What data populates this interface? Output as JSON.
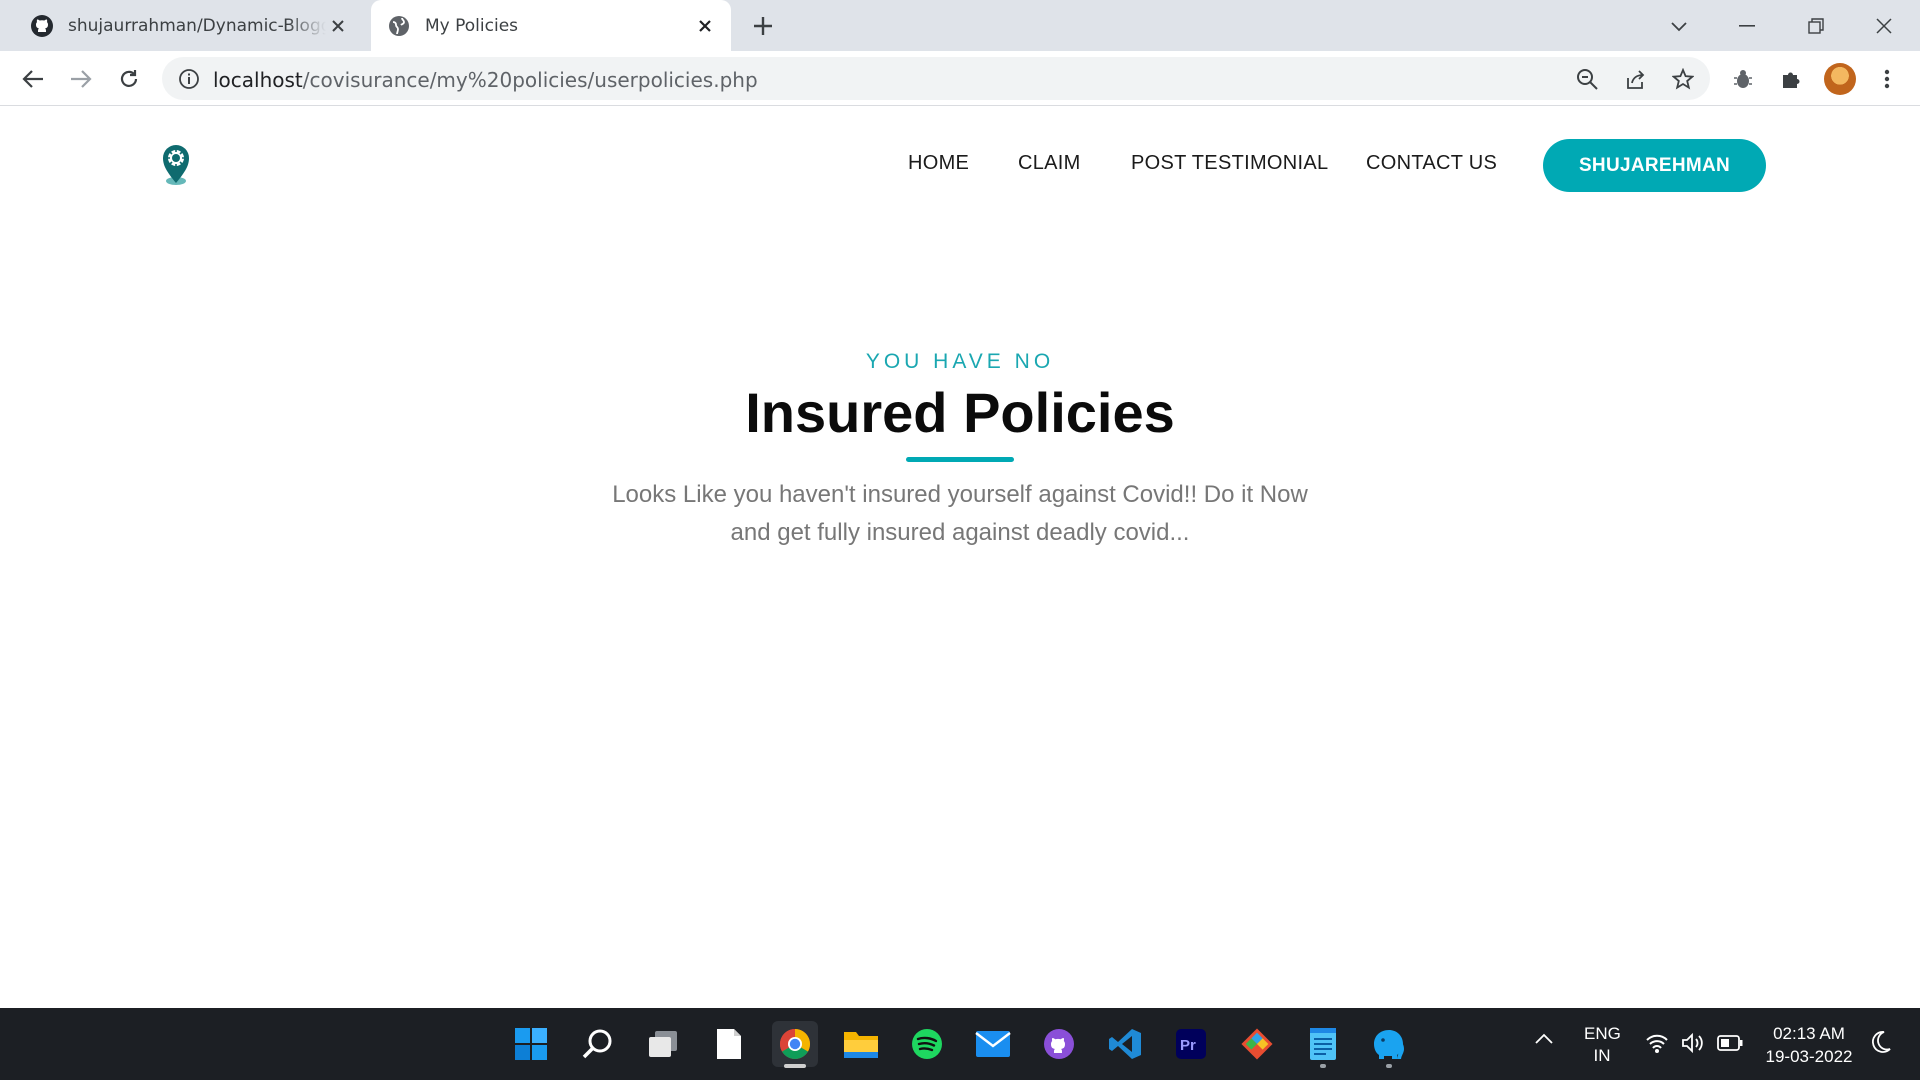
{
  "browser": {
    "tabs": [
      {
        "title": "shujaurrahman/Dynamic-Blogger",
        "icon": "github-icon",
        "active": false
      },
      {
        "title": "My Policies",
        "icon": "globe-icon",
        "active": true
      }
    ],
    "url_host": "localhost",
    "url_path": "/covisurance/my%20policies/userpolicies.php"
  },
  "site": {
    "nav": [
      "HOME",
      "CLAIM",
      "POST TESTIMONIAL",
      "CONTACT US"
    ],
    "user_button": "SHUJAREHMAN",
    "accent_color": "#00a9b4"
  },
  "hero": {
    "eyebrow": "YOU HAVE NO",
    "title": "Insured Policies",
    "description": "Looks Like you haven't insured yourself against Covid!! Do it Now and get fully insured against deadly covid..."
  },
  "taskbar": {
    "apps": [
      "windows-start-icon",
      "search-icon",
      "task-view-icon",
      "notepad-file-icon",
      "chrome-icon",
      "file-explorer-icon",
      "spotify-icon",
      "mail-icon",
      "github-desktop-icon",
      "vscode-icon",
      "premiere-pro-icon",
      "git-icon",
      "notepad-icon",
      "elephant-app-icon"
    ],
    "language": "ENG",
    "region": "IN",
    "time": "02:13 AM",
    "date": "19-03-2022"
  }
}
